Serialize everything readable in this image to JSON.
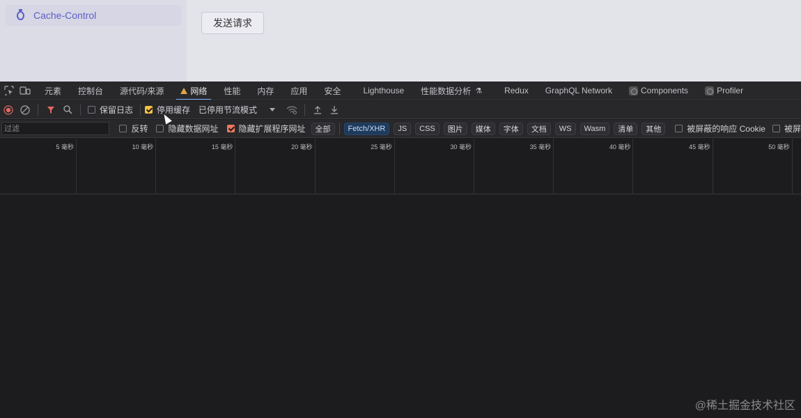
{
  "page": {
    "sidebar_item": "Cache-Control",
    "send_button": "发送请求"
  },
  "devtools": {
    "tabs": [
      "元素",
      "控制台",
      "源代码/来源",
      "网络",
      "性能",
      "内存",
      "应用",
      "安全",
      "Lighthouse",
      "性能数据分析",
      "Redux",
      "GraphQL Network",
      "Components",
      "Profiler"
    ],
    "active_tab": "网络",
    "toolbar": {
      "preserve_log": "保留日志",
      "preserve_log_checked": false,
      "disable_cache": "停用缓存",
      "disable_cache_checked": true,
      "throttling": "已停用节流模式"
    },
    "filter": {
      "placeholder": "过滤",
      "invert": "反转",
      "hide_data_urls": "隐藏数据网址",
      "hide_extension_urls": "隐藏扩展程序网址",
      "types": [
        "全部",
        "Fetch/XHR",
        "JS",
        "CSS",
        "图片",
        "媒体",
        "字体",
        "文档",
        "WS",
        "Wasm",
        "清单",
        "其他"
      ],
      "selected_type": "Fetch/XHR",
      "blocked_cookies": "被屏蔽的响应 Cookie",
      "blocked_requests": "被屏"
    },
    "timeline_ticks": [
      "5 毫秒",
      "10 毫秒",
      "15 毫秒",
      "20 毫秒",
      "25 毫秒",
      "30 毫秒",
      "35 毫秒",
      "40 毫秒",
      "45 毫秒",
      "50 毫秒"
    ]
  },
  "watermark": "@稀土掘金技术社区",
  "colors": {
    "accent": "#7cacf8",
    "checkbox_on": "#f4c143",
    "brand_purple": "#5b5fc7",
    "selected_chip": "#1e3a5c"
  }
}
